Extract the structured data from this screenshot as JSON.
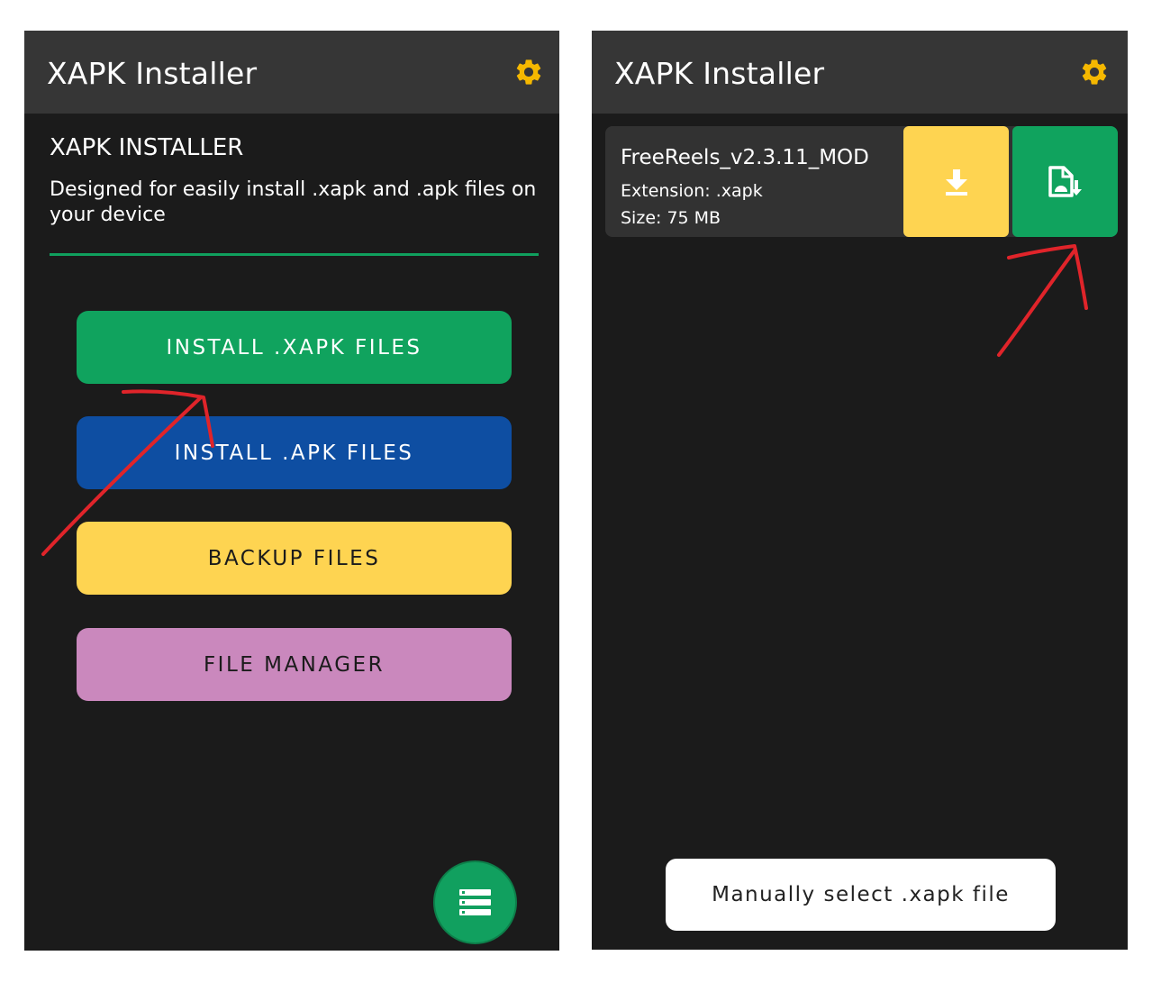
{
  "colors": {
    "background": "#1b1b1b",
    "appbar": "#363636",
    "accent_gear": "#f5b800",
    "green": "#10a35e",
    "blue": "#0e4ea2",
    "yellow": "#fed451",
    "pink": "#ca88bd",
    "annotation_red": "#e0242a"
  },
  "left_screen": {
    "appbar": {
      "title": "XAPK Installer",
      "settings_icon": "gear-icon"
    },
    "heading": "XAPK INSTALLER",
    "description": "Designed for easily install .xapk and .apk files on your device",
    "buttons": [
      {
        "label": "INSTALL .XAPK FILES",
        "color": "#10a35e",
        "text_color": "#ffffff"
      },
      {
        "label": "INSTALL .APK FILES",
        "color": "#0e4ea2",
        "text_color": "#ffffff"
      },
      {
        "label": "BACKUP FILES",
        "color": "#fed451",
        "text_color": "#1b1b1b"
      },
      {
        "label": "FILE MANAGER",
        "color": "#ca88bd",
        "text_color": "#1b1b1b"
      }
    ],
    "fab_icon": "list-icon"
  },
  "right_screen": {
    "appbar": {
      "title": "XAPK Installer",
      "settings_icon": "gear-icon"
    },
    "file": {
      "name": "FreeReels_v2.3.11_MOD",
      "extension": "Extension: .xapk",
      "size": "Size: 75 MB",
      "download_icon": "download-icon",
      "install_icon": "install-file-icon"
    },
    "manual_button": "Manually select .xapk file"
  }
}
